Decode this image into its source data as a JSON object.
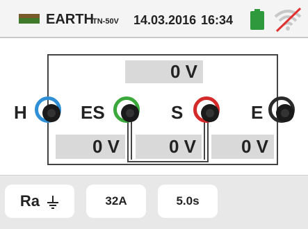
{
  "header": {
    "icon": "ground-icon",
    "function": "EARTH",
    "mode": "TN-50V",
    "date": "14.03.2016",
    "time": "16:34",
    "battery_icon": "battery-icon",
    "battery_color": "#2f9a3d",
    "wifi_icon": "wifi-off-icon",
    "wifi_cross_color": "#e03030"
  },
  "circuit": {
    "top_voltage": "0 V",
    "terminals": [
      {
        "label": "H",
        "ring_color": "#2f8fd6"
      },
      {
        "label": "ES",
        "ring_color": "#3aa83a"
      },
      {
        "label": "S",
        "ring_color": "#d42a2a"
      },
      {
        "label": "E",
        "ring_color": "#2a2a2a"
      }
    ],
    "voltages": [
      "0 V",
      "0 V",
      "0 V"
    ]
  },
  "footer": {
    "measure": "Ra",
    "measure_icon": "earth-ground-icon",
    "current": "32A",
    "time": "5.0s"
  }
}
